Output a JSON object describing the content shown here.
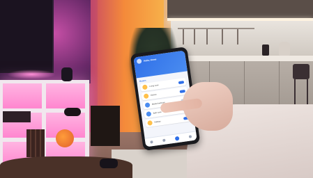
{
  "scene": {
    "subject": "hand-holding-phone-smart-home-app",
    "colors": {
      "accent_blue": "#2f6fe8",
      "wall_pink": "#c64fa6",
      "wall_orange": "#f48a3a",
      "kitchen_white": "#e9e4de"
    }
  },
  "phone_app": {
    "header_title": "Hello, Home",
    "header_subtitle": "",
    "section_label": "Rooms",
    "rooms": [
      {
        "label": "Living room",
        "icon": "bulb-icon",
        "on": true
      },
      {
        "label": "Kitchen",
        "icon": "bulb-icon",
        "on": true
      },
      {
        "label": "Master bedroom",
        "icon": "bulb-icon",
        "on": false
      },
      {
        "label": "Bath room",
        "icon": "bulb-icon",
        "on": false
      },
      {
        "label": "Hallway",
        "icon": "bulb-icon",
        "on": true
      }
    ],
    "nav_items": [
      "home-icon",
      "grid-icon",
      "add-icon",
      "settings-icon"
    ]
  }
}
